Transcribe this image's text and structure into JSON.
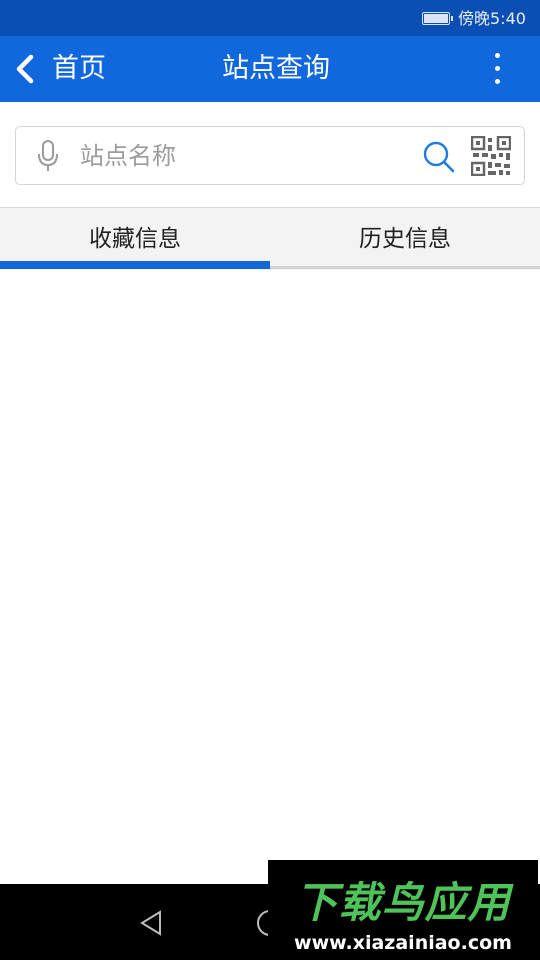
{
  "status_bar": {
    "time": "傍晚5:40",
    "battery_icon": "battery-full-icon"
  },
  "app_bar": {
    "back_label": "首页",
    "title": "站点查询",
    "back_icon": "chevron-left-icon",
    "more_icon": "more-vertical-icon",
    "background_color": "#1167dc"
  },
  "search": {
    "value": "",
    "placeholder": "站点名称",
    "mic_icon": "microphone-icon",
    "search_icon": "search-icon",
    "qr_icon": "qr-code-icon"
  },
  "tabs": [
    {
      "label": "收藏信息",
      "selected": true
    },
    {
      "label": "历史信息",
      "selected": false
    }
  ],
  "nav_bar": {
    "back_icon": "triangle-back-icon",
    "home_icon": "circle-home-icon"
  },
  "watermark": {
    "logo": "下载鸟应用",
    "url": "www.xiazainiao.com"
  }
}
